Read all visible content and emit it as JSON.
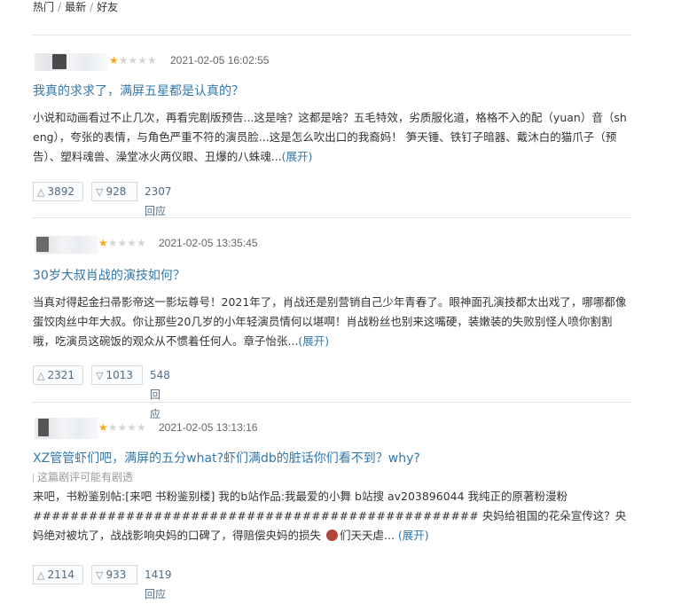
{
  "nav": {
    "hot": "热门",
    "sep1": "/",
    "latest": "最新",
    "sep2": "/",
    "friends": "好友"
  },
  "reviews": [
    {
      "rating": 1,
      "time": "2021-02-05 16:02:55",
      "title": "我真的求求了，满屏五星都是认真的？",
      "spoiler": "",
      "body": "小说和动画看过不止几次，再看完剧版预告...这是啥？这都是啥？五毛特效，劣质服化道，格格不入的配（yuan）音（sheng），夸张的表情，与角色严重不符的演员脸...这是怎么吹出口的我裔妈！ 笋天锤、铁钉子暗器、戴沐白的猫爪子（预告）、塑料魂兽、澡堂冰火两仪眼、丑爆的八蛛魂...",
      "expand": "(展开)",
      "useful": "3892",
      "useless": "928",
      "replies": "2307回应"
    },
    {
      "rating": 1,
      "time": "2021-02-05 13:35:45",
      "title": "30岁大叔肖战的演技如何？",
      "spoiler": "",
      "body": "当真对得起金扫帚影帝这一影坛尊号！2021年了，肖战还是别营销自己少年青春了。眼神面孔演技都太出戏了，哪哪都像蛋饺肉丝中年大叔。你让那些20几岁的小年轻演员情何以堪啊！肖战粉丝也别来这嘴硬，装嫩装的失败别怪人喷你割割哦，吃演员这碗饭的观众从不惯着任何人。章子怡张...",
      "expand": "(展开)",
      "useful": "2321",
      "useless": "1013",
      "replies": "548回应"
    },
    {
      "rating": 1,
      "time": "2021-02-05 13:13:16",
      "title": "XZ管管虾们吧，满屏的五分what?虾们满db的脏话你们看不到？why?",
      "spoiler": "这篇剧评可能有剧透",
      "body_line1": "来吧，书粉鉴别帖:[来吧 书粉鉴别楼] 我的b站作品:我最爱的小舞 b站搜 av203896044 我纯正的原著粉漫粉",
      "body_line2": "################################################ 央妈给祖国的花朵宣传这？央妈绝对被坑了，战战影响央妈的口碑了，得赔偿央妈的损失",
      "body_line3": "们天天虐...",
      "emoji_name": "cat-face-emoji",
      "expand": "(展开)",
      "useful": "2114",
      "useless": "933",
      "replies": "1419回应"
    }
  ]
}
